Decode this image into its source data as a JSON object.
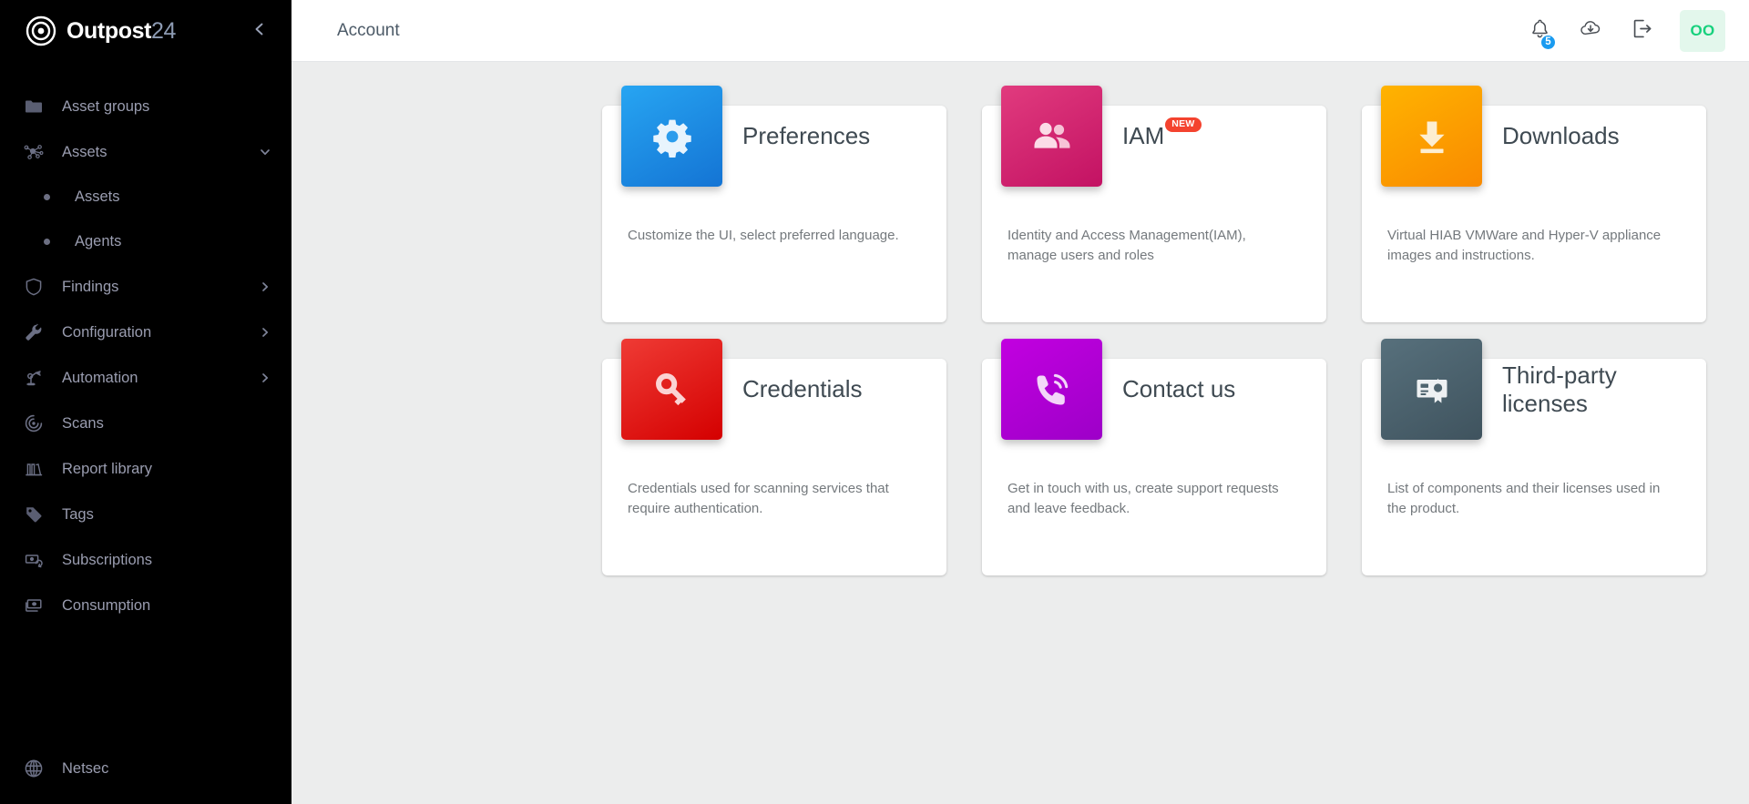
{
  "brand": {
    "name_primary": "Outpost",
    "name_secondary": "24",
    "logo_icon": "bullseye-target-icon",
    "collapse_icon": "chevron-left-icon"
  },
  "sidebar": {
    "items": [
      {
        "label": "Asset groups",
        "icon": "folder-icon",
        "chevron": "",
        "level": "top"
      },
      {
        "label": "Assets",
        "icon": "network-nodes-icon",
        "chevron": "chevron-down-icon",
        "level": "top"
      },
      {
        "label": "Assets",
        "icon": "bullet-dot-icon",
        "chevron": "",
        "level": "sub"
      },
      {
        "label": "Agents",
        "icon": "bullet-dot-icon",
        "chevron": "",
        "level": "sub"
      },
      {
        "label": "Findings",
        "icon": "shield-icon",
        "chevron": "chevron-right-icon",
        "level": "top"
      },
      {
        "label": "Configuration",
        "icon": "wrench-icon",
        "chevron": "chevron-right-icon",
        "level": "top"
      },
      {
        "label": "Automation",
        "icon": "robot-arm-icon",
        "chevron": "chevron-right-icon",
        "level": "top"
      },
      {
        "label": "Scans",
        "icon": "radar-scan-icon",
        "chevron": "",
        "level": "top"
      },
      {
        "label": "Report library",
        "icon": "books-library-icon",
        "chevron": "",
        "level": "top"
      },
      {
        "label": "Tags",
        "icon": "tag-icon",
        "chevron": "",
        "level": "top"
      },
      {
        "label": "Subscriptions",
        "icon": "subscription-renew-icon",
        "chevron": "",
        "level": "top"
      },
      {
        "label": "Consumption",
        "icon": "banknote-icon",
        "chevron": "",
        "level": "top"
      }
    ],
    "footer": {
      "label": "Netsec",
      "icon": "globe-icon"
    }
  },
  "header": {
    "title": "Account",
    "notifications": {
      "icon": "bell-icon",
      "badge_count": "5",
      "badge_color": "#1a9bf0"
    },
    "cloud_download": {
      "icon": "cloud-download-icon"
    },
    "logout": {
      "icon": "logout-icon"
    },
    "avatar": {
      "initials": "OO",
      "bg_color": "#e3f7ec",
      "text_color": "#17d17d"
    }
  },
  "cards": [
    {
      "title": "Preferences",
      "description": "Customize the UI, select preferred language.",
      "icon": "gear-icon",
      "badge": "",
      "color_from": "#27a5f2",
      "color_to": "#1474d4"
    },
    {
      "title": "IAM",
      "description": "Identity and Access Management(IAM), manage users and roles",
      "icon": "users-group-icon",
      "badge": "NEW",
      "color_from": "#e13b7e",
      "color_to": "#c31263"
    },
    {
      "title": "Downloads",
      "description": "Virtual HIAB VMWare and Hyper-V appliance images and instructions.",
      "icon": "download-arrow-icon",
      "badge": "",
      "color_from": "#ffb300",
      "color_to": "#f98a00"
    },
    {
      "title": "Credentials",
      "description": "Credentials used for scanning services that require authentication.",
      "icon": "key-icon",
      "badge": "",
      "color_from": "#ef3b35",
      "color_to": "#d40000"
    },
    {
      "title": "Contact us",
      "description": "Get in touch with us, create support requests and leave feedback.",
      "icon": "phone-ring-icon",
      "badge": "",
      "color_from": "#c200e0",
      "color_to": "#9d00c8"
    },
    {
      "title": "Third-party licenses",
      "description": "List of components and their licenses used in the product.",
      "icon": "certificate-license-icon",
      "badge": "",
      "color_from": "#57707c",
      "color_to": "#3f535e"
    }
  ]
}
